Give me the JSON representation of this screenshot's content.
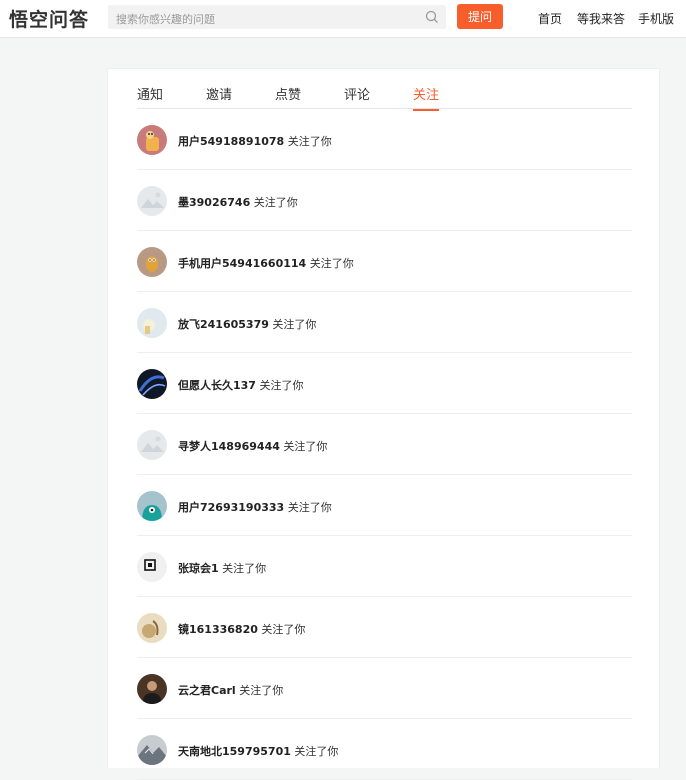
{
  "header": {
    "logo_text": "悟空问答",
    "search_placeholder": "搜索你感兴趣的问题",
    "ask_label": "提问",
    "nav": [
      "首页",
      "等我来答",
      "手机版"
    ]
  },
  "tabs": [
    {
      "label": "通知",
      "active": false
    },
    {
      "label": "邀请",
      "active": false
    },
    {
      "label": "点赞",
      "active": false
    },
    {
      "label": "评论",
      "active": false
    },
    {
      "label": "关注",
      "active": true
    }
  ],
  "action_text": "关注了你",
  "notifications": [
    {
      "name": "用户54918891078",
      "avatar": "cartoon-orange"
    },
    {
      "name": "墨39026746",
      "avatar": "default-gray"
    },
    {
      "name": "手机用户54941660114",
      "avatar": "cartoon-owl"
    },
    {
      "name": "放飞241605379",
      "avatar": "light-blue"
    },
    {
      "name": "但愿人长久137",
      "avatar": "dark-blue"
    },
    {
      "name": "寻梦人148969444",
      "avatar": "default-gray"
    },
    {
      "name": "用户72693190333",
      "avatar": "teal-monster"
    },
    {
      "name": "张琼会1",
      "avatar": "qr-white"
    },
    {
      "name": "镜161336820",
      "avatar": "beige-photo"
    },
    {
      "name": "云之君Carl",
      "avatar": "man-photo"
    },
    {
      "name": "天南地北159795701",
      "avatar": "gray-photo"
    }
  ]
}
